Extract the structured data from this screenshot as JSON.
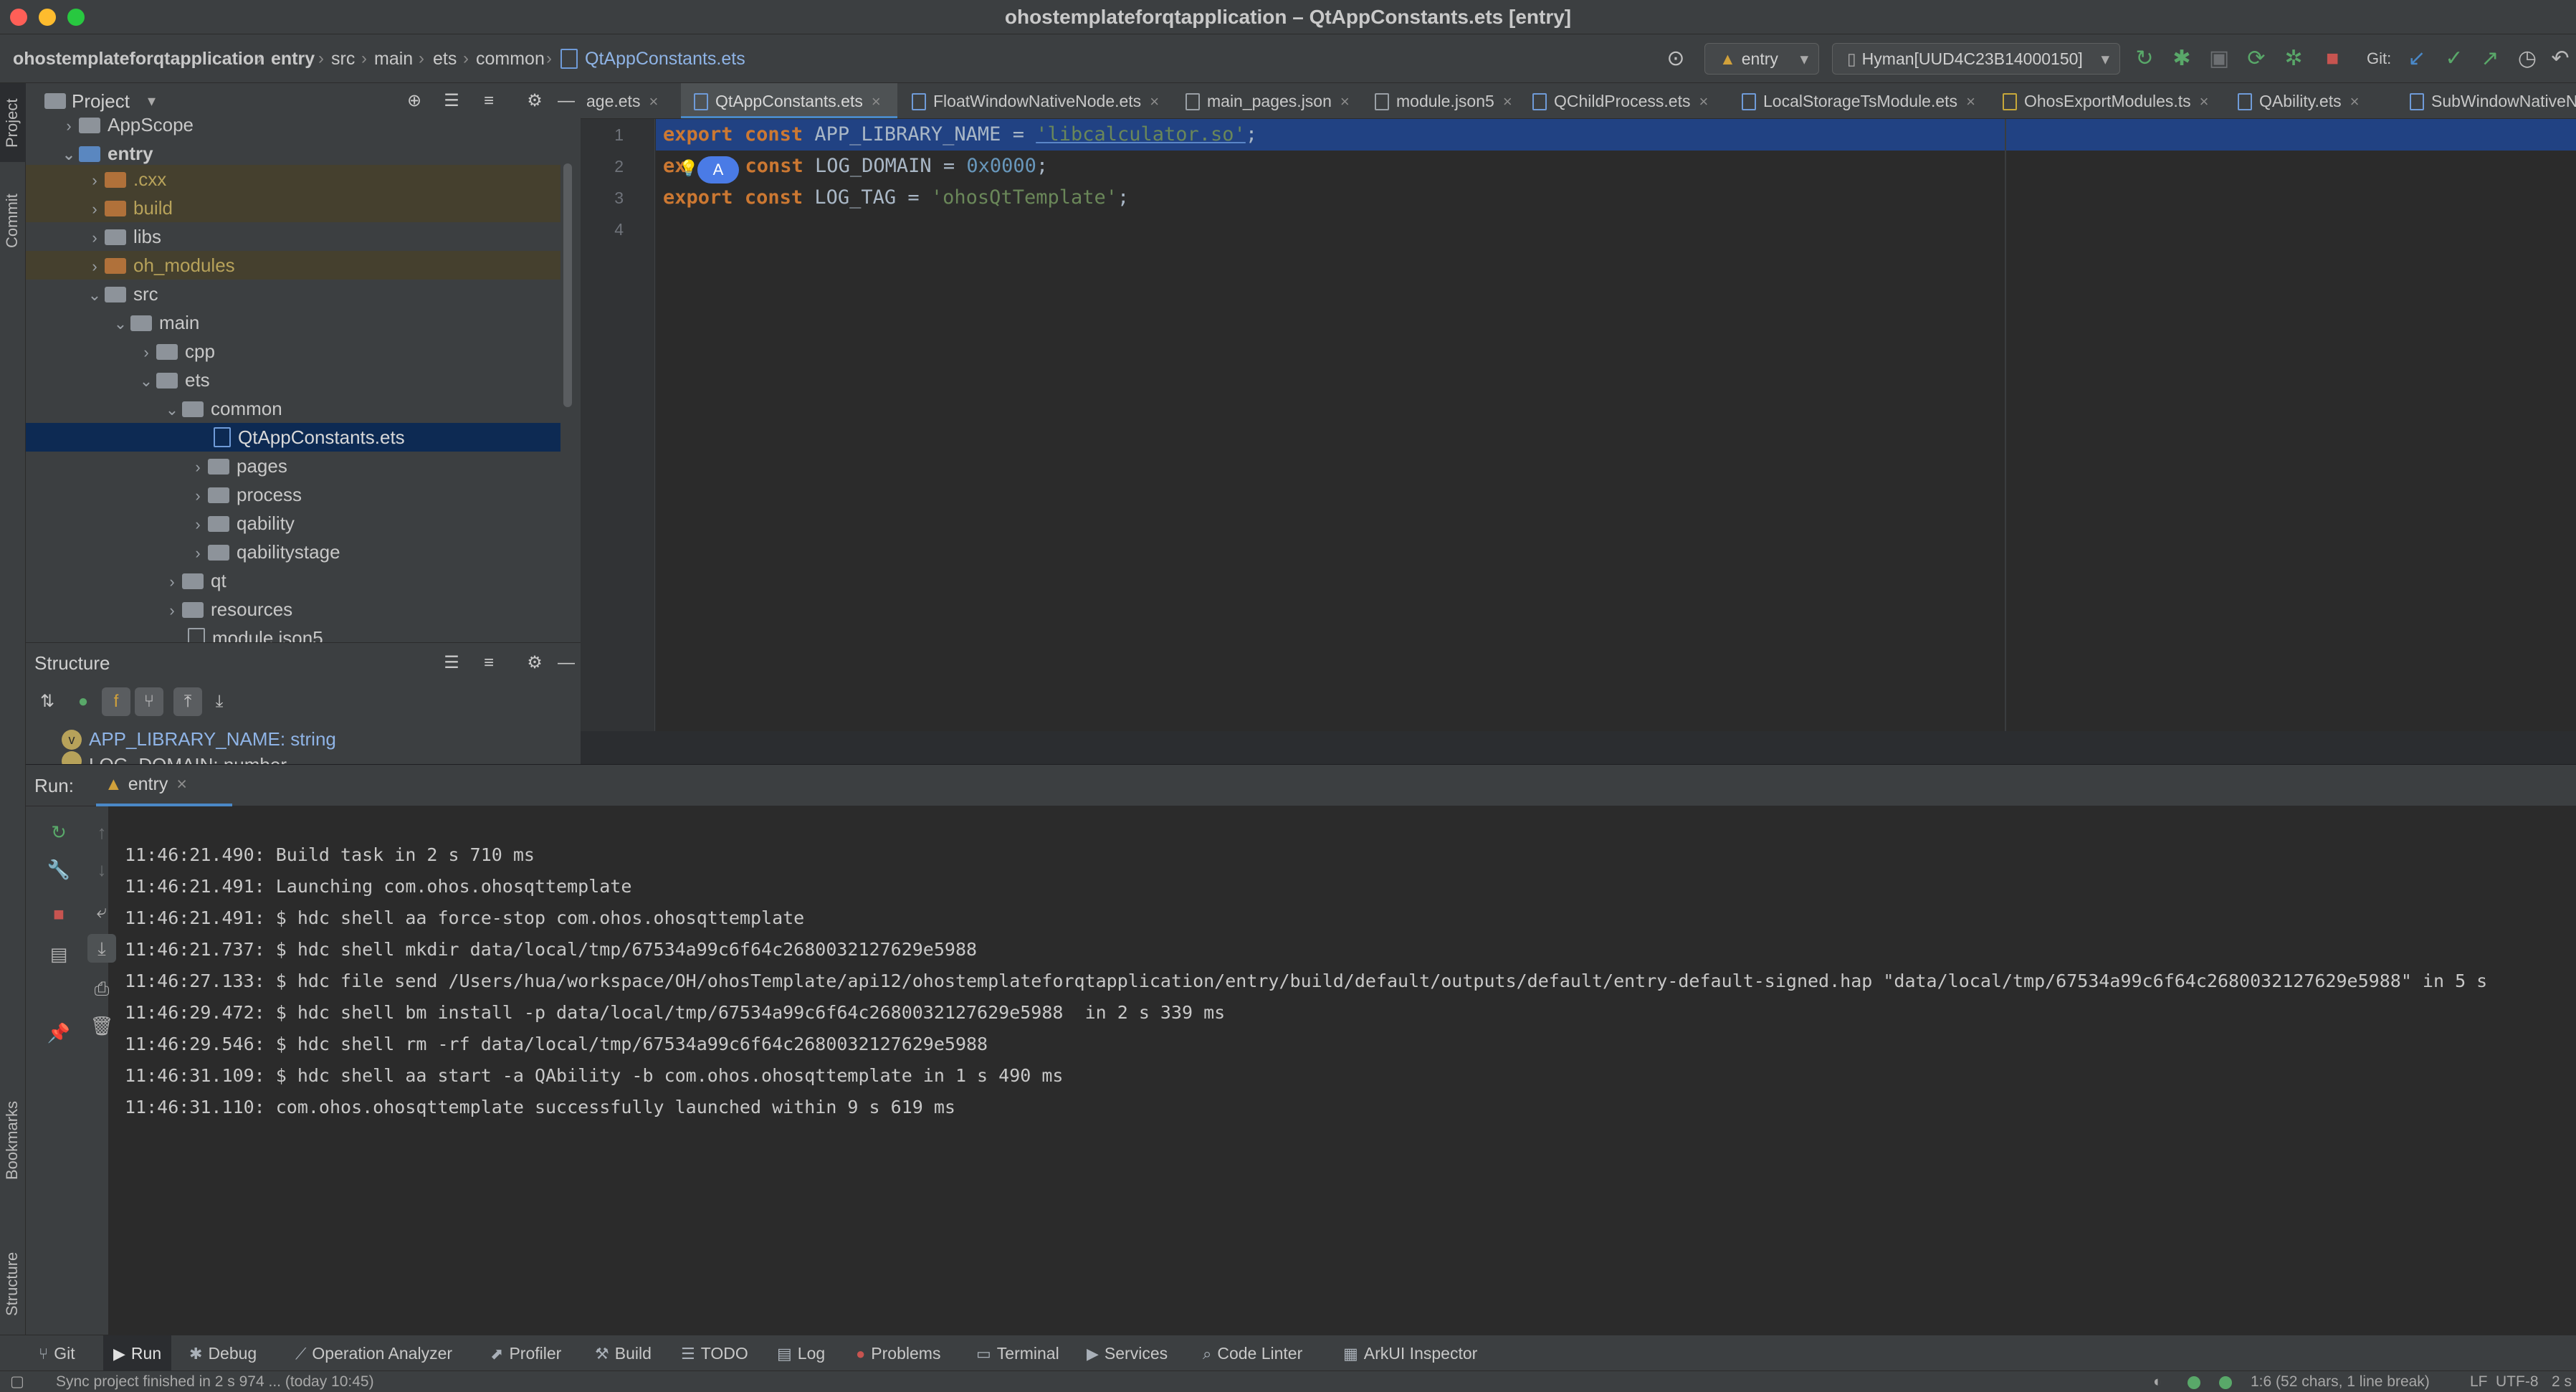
{
  "window": {
    "title": "ohostemplateforqtapplication – QtAppConstants.ets [entry]"
  },
  "breadcrumb": [
    "ohostemplateforqtapplication",
    "entry",
    "src",
    "main",
    "ets",
    "common",
    "QtAppConstants.ets"
  ],
  "toolbar": {
    "run_config": "entry",
    "device": "Hyman[UUD4C23B14000150]",
    "git_label": "Git:"
  },
  "project_panel": {
    "title": "Project",
    "tree": [
      {
        "label": "AppScope",
        "expanded": false
      },
      {
        "label": "entry",
        "expanded": true
      },
      {
        "label": ".cxx",
        "expanded": false
      },
      {
        "label": "build",
        "expanded": false
      },
      {
        "label": "libs",
        "expanded": false
      },
      {
        "label": "oh_modules",
        "expanded": false
      },
      {
        "label": "src",
        "expanded": true
      },
      {
        "label": "main",
        "expanded": true
      },
      {
        "label": "cpp",
        "expanded": false
      },
      {
        "label": "ets",
        "expanded": true
      },
      {
        "label": "common",
        "expanded": true
      },
      {
        "label": "QtAppConstants.ets",
        "selected": true
      },
      {
        "label": "pages",
        "expanded": false
      },
      {
        "label": "process",
        "expanded": false
      },
      {
        "label": "qability",
        "expanded": false
      },
      {
        "label": "qabilitystage",
        "expanded": false
      },
      {
        "label": "qt",
        "expanded": false
      },
      {
        "label": "resources",
        "expanded": false
      },
      {
        "label": "module.json5"
      }
    ]
  },
  "structure_panel": {
    "title": "Structure",
    "items": [
      "APP_LIBRARY_NAME: string",
      "LOG_DOMAIN: number"
    ]
  },
  "editor": {
    "tabs": [
      {
        "label": "age.ets",
        "active": false
      },
      {
        "label": "QtAppConstants.ets",
        "active": true
      },
      {
        "label": "FloatWindowNativeNode.ets",
        "active": false
      },
      {
        "label": "main_pages.json",
        "active": false
      },
      {
        "label": "module.json5",
        "active": false
      },
      {
        "label": "QChildProcess.ets",
        "active": false
      },
      {
        "label": "LocalStorageTsModule.ets",
        "active": false
      },
      {
        "label": "OhosExportModules.ts",
        "active": false
      },
      {
        "label": "QAbility.ets",
        "active": false
      },
      {
        "label": "SubWindowNativeNode",
        "active": false
      }
    ],
    "line_numbers": [
      "1",
      "2",
      "3",
      "4"
    ],
    "code": {
      "l1_kw1": "export",
      "l1_kw2": "const",
      "l1_name": " APP_LIBRARY_NAME = ",
      "l1_str": "'libcalculator.so'",
      "l1_end": ";",
      "l2_kw_prefix": "ex",
      "l2_kw2": "const",
      "l2_name": " LOG_DOMAIN = ",
      "l2_num": "0x0000",
      "l2_end": ";",
      "l3_kw1": "export",
      "l3_kw2": "const",
      "l3_name": " LOG_TAG = ",
      "l3_str": "'ohosQtTemplate'",
      "l3_end": ";"
    },
    "avatar_letter": "A"
  },
  "run_panel": {
    "label": "Run:",
    "tab": "entry",
    "log": [
      "11:46:21.490: Build task in 2 s 710 ms",
      "11:46:21.491: Launching com.ohos.ohosqttemplate",
      "11:46:21.491: $ hdc shell aa force-stop com.ohos.ohosqttemplate",
      "11:46:21.737: $ hdc shell mkdir data/local/tmp/67534a99c6f64c2680032127629e5988",
      "11:46:27.133: $ hdc file send /Users/hua/workspace/OH/ohosTemplate/api12/ohostemplateforqtapplication/entry/build/default/outputs/default/entry-default-signed.hap \"data/local/tmp/67534a99c6f64c2680032127629e5988\" in 5 s",
      "11:46:29.472: $ hdc shell bm install -p data/local/tmp/67534a99c6f64c2680032127629e5988  in 2 s 339 ms",
      "11:46:29.546: $ hdc shell rm -rf data/local/tmp/67534a99c6f64c2680032127629e5988",
      "11:46:31.109: $ hdc shell aa start -a QAbility -b com.ohos.ohosqttemplate in 1 s 490 ms",
      "11:46:31.110: com.ohos.ohosqttemplate successfully launched within 9 s 619 ms"
    ]
  },
  "side_stripe": {
    "project": "Project",
    "commit": "Commit",
    "bookmarks": "Bookmarks",
    "structure": "Structure"
  },
  "bottom_tools": [
    "Git",
    "Run",
    "Debug",
    "Operation Analyzer",
    "Profiler",
    "Build",
    "TODO",
    "Log",
    "Problems",
    "Terminal",
    "Services",
    "Code Linter",
    "ArkUI Inspector"
  ],
  "status": {
    "message": "Sync project finished in 2 s 974 ... (today 10:45)",
    "position": "1:6 (52 chars, 1 line break)",
    "line_sep": "LF",
    "encoding": "UTF-8",
    "indent": "2 s"
  },
  "colors": {
    "accent": "#4a88c7",
    "selection": "#214283",
    "keyword": "#cc7832",
    "string": "#6a8759",
    "number": "#6897bb",
    "run_green": "#59a869",
    "stop_red": "#c75450"
  }
}
